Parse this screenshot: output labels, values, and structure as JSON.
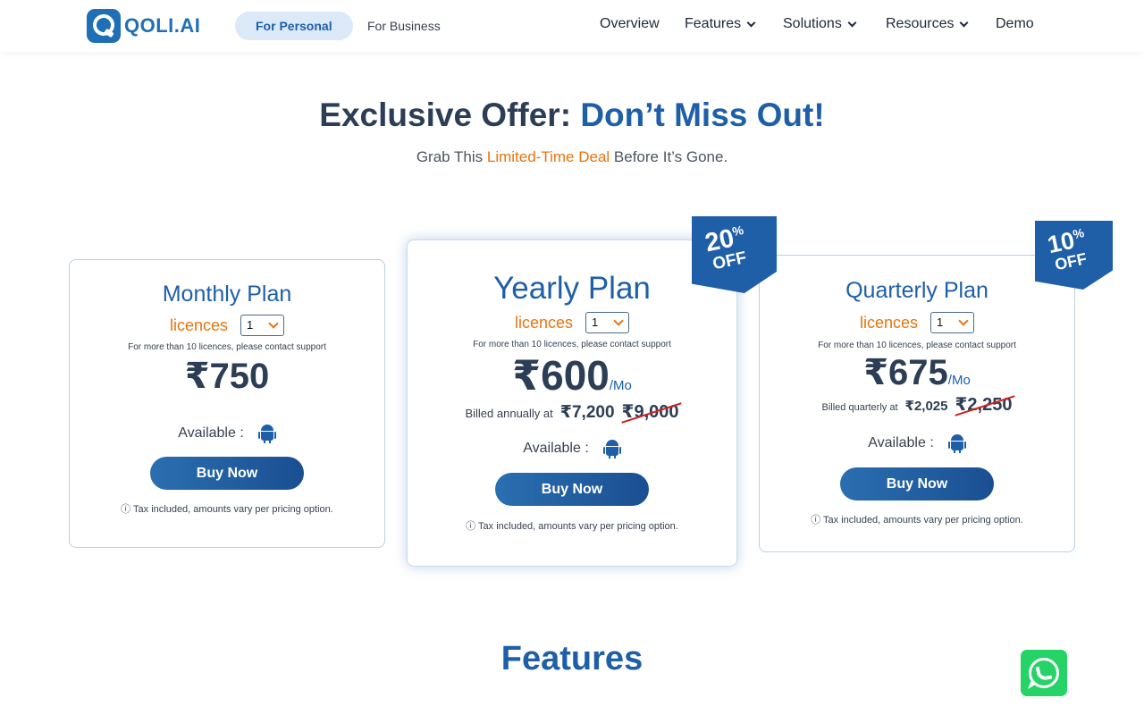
{
  "header": {
    "logo_text": "QOLI.AI",
    "segments": {
      "personal": "For Personal",
      "business": "For Business"
    },
    "nav": {
      "overview": "Overview",
      "features": "Features",
      "solutions": "Solutions",
      "resources": "Resources",
      "demo": "Demo"
    }
  },
  "hero": {
    "title_part1": "Exclusive Offer: ",
    "title_part2": "Don’t Miss Out!",
    "sub_part1": "Grab This ",
    "sub_highlight": "Limited-Time Deal",
    "sub_part2": " Before It’s Gone."
  },
  "plans": [
    {
      "title": "Monthly Plan",
      "licences_label": "licences",
      "licences_value": "1",
      "note": "For more than 10 licences, please contact support",
      "price": "₹750",
      "available_label": "Available :",
      "buy_label": "Buy Now",
      "tax_note": "ⓘ Tax included, amounts vary per pricing option."
    },
    {
      "title": "Yearly Plan",
      "licences_label": "licences",
      "licences_value": "1",
      "note": "For more than 10 licences, please contact support",
      "price": "₹600",
      "per": "/Mo",
      "billed_label": "Billed annually at",
      "billed_amount": "₹7,200",
      "billed_old": "₹9,000",
      "available_label": "Available :",
      "buy_label": "Buy Now",
      "tax_note": "ⓘ Tax included, amounts vary per pricing option.",
      "ribbon": {
        "value": "20",
        "pct": "%",
        "off": "OFF"
      }
    },
    {
      "title": "Quarterly Plan",
      "licences_label": "licences",
      "licences_value": "1",
      "note": "For more than 10 licences, please contact support",
      "price": "₹675",
      "per": "/Mo",
      "billed_label": "Billed quarterly at",
      "billed_amount": "₹2,025",
      "billed_old": "₹2,250",
      "available_label": "Available :",
      "buy_label": "Buy Now",
      "tax_note": "ⓘ Tax included, amounts vary per pricing option.",
      "ribbon": {
        "value": "10",
        "pct": "%",
        "off": "OFF"
      }
    }
  ],
  "features_heading": "Features",
  "icons": {
    "logo": "qoli-logo-icon",
    "dropdown": "chevron-down-icon",
    "platform": "android-icon",
    "chat": "whatsapp-icon"
  },
  "colors": {
    "brand_blue": "#1e5fa8",
    "accent_orange": "#e8740c",
    "strike_red": "#d11f1f",
    "whatsapp_green": "#25d366"
  }
}
